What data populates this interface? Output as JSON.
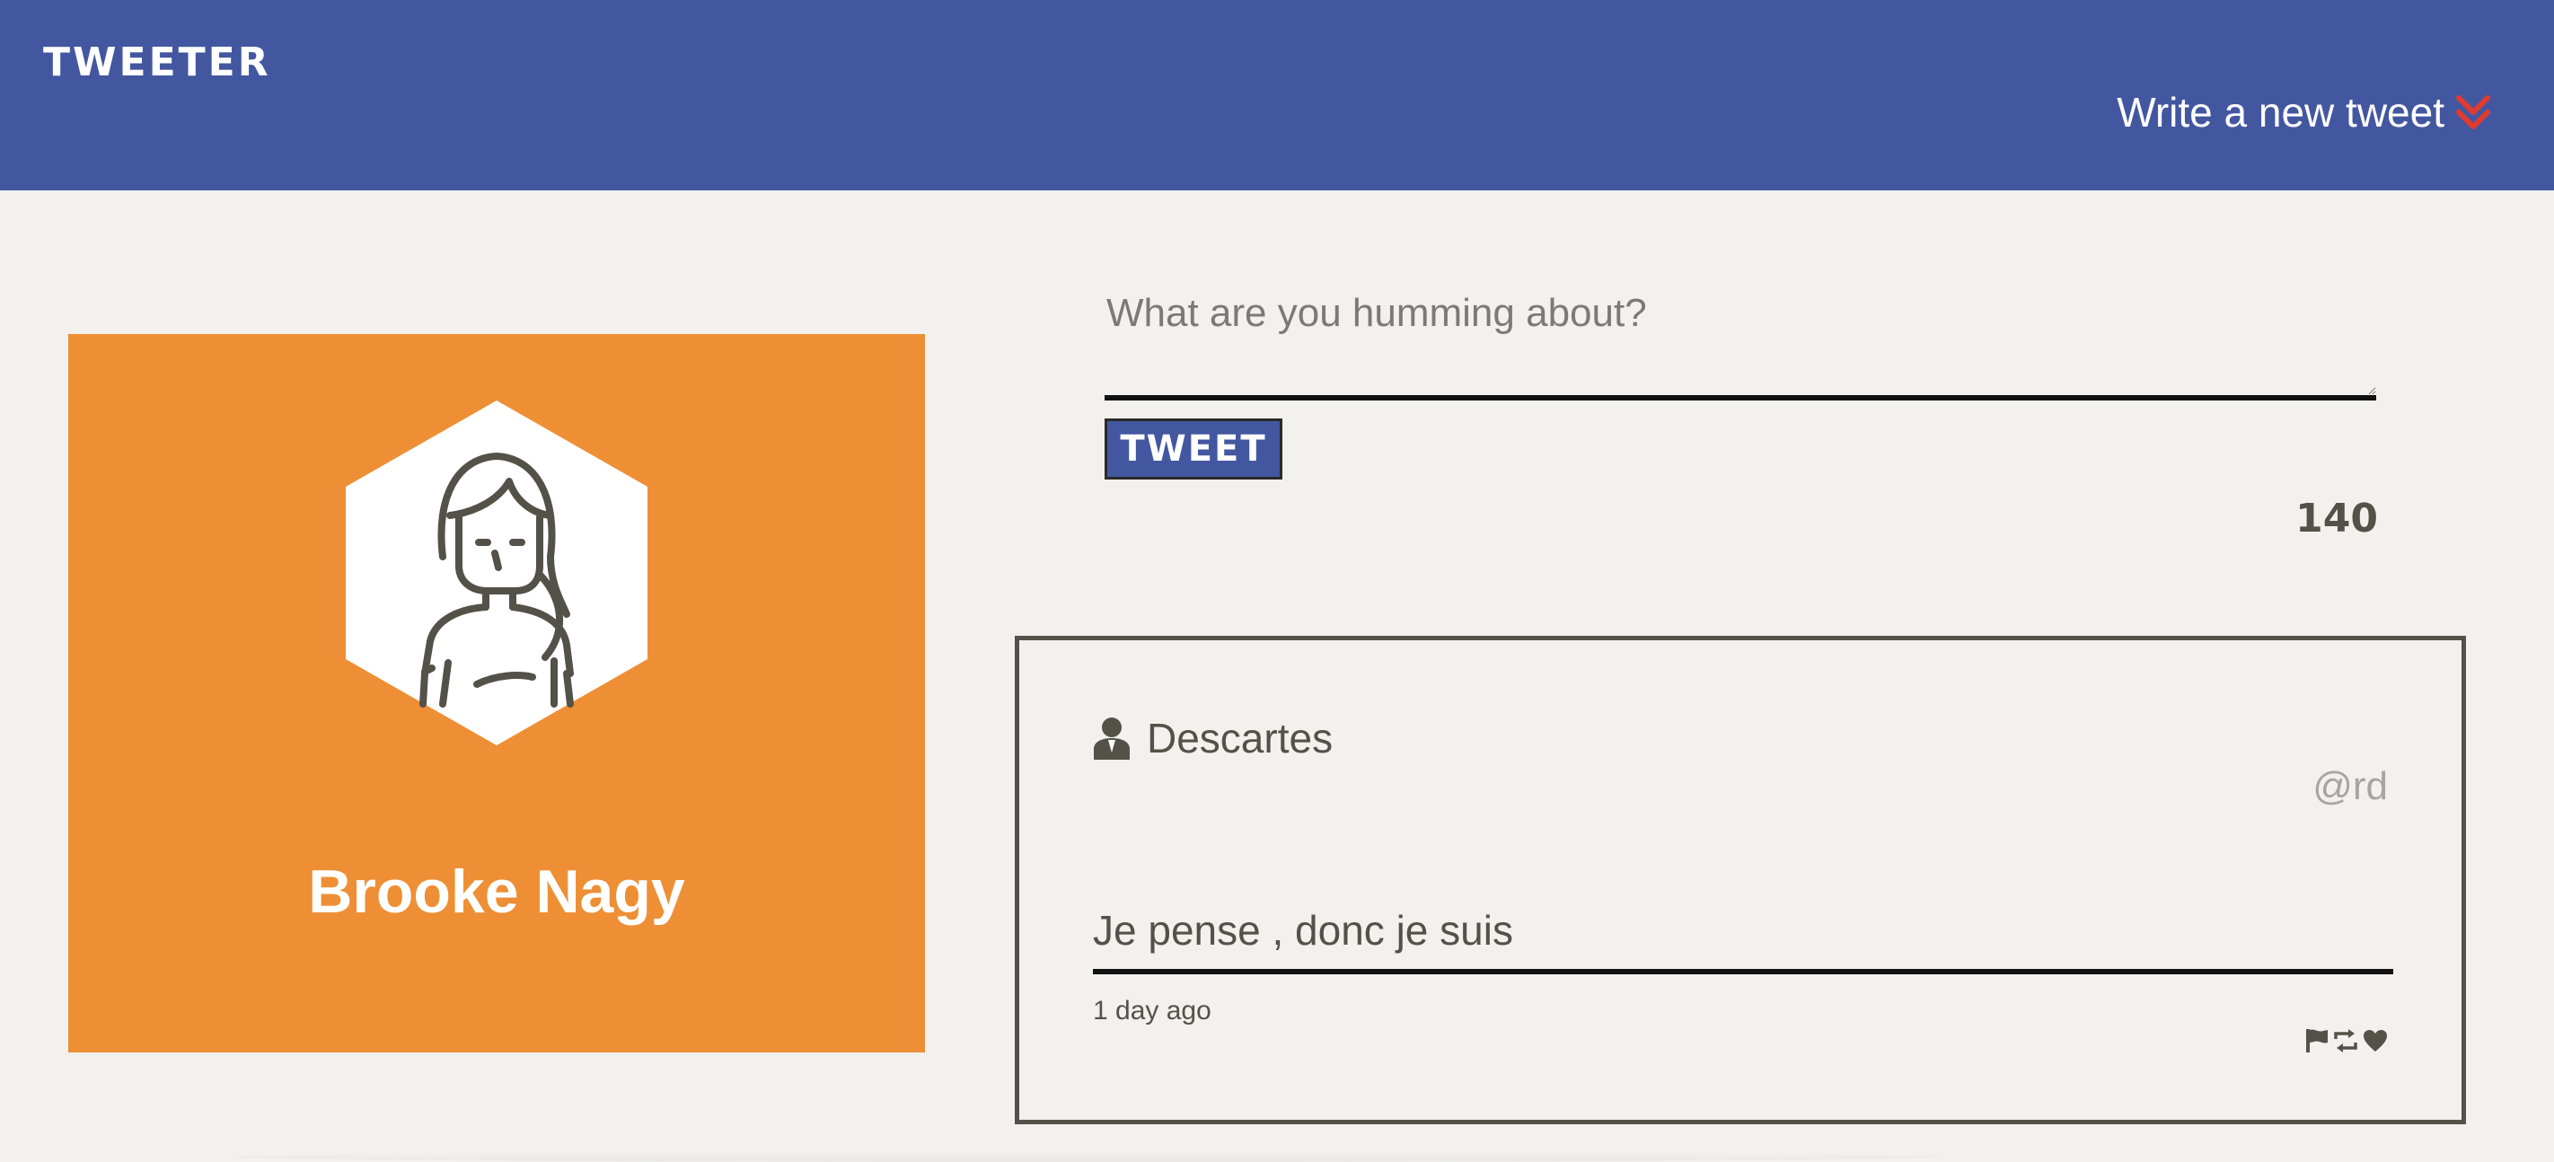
{
  "header": {
    "brand": "TWEETER",
    "compose_toggle_label": "Write a new tweet",
    "toggle_icon": "double-chevron-down-icon",
    "background_color": "#4357a0",
    "accent_color": "#e03b30"
  },
  "profile": {
    "name": "Brooke Nagy",
    "avatar_icon": "user-avatar-hexagon-icon",
    "background_color": "#ee8f35"
  },
  "composer": {
    "placeholder": "What are you humming about?",
    "value": "",
    "submit_label": "TWEET",
    "char_counter": "140"
  },
  "tweets": [
    {
      "author_icon": "person-icon",
      "author": "Descartes",
      "handle": "@rd",
      "content": "Je pense , donc je suis",
      "timestamp": "1 day ago",
      "actions": [
        "flag-icon",
        "retweet-icon",
        "heart-icon"
      ]
    }
  ]
}
